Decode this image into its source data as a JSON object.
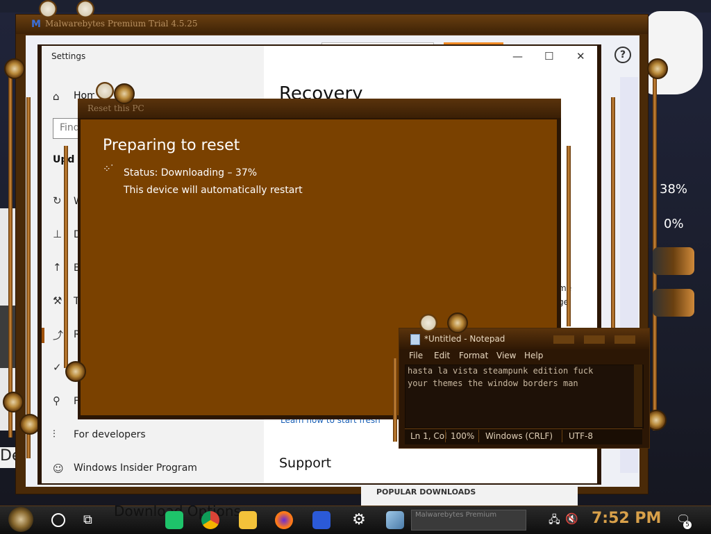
{
  "desktop": {
    "percent_1": "38%",
    "percent_2": "0%",
    "side_text": "Des"
  },
  "malwarebytes": {
    "title": "Malwarebytes Premium Trial  4.5.25",
    "help_glyph": "?",
    "popular_downloads_label": "POPULAR DOWNLOADS"
  },
  "settings": {
    "window_title": "Settings",
    "controls": {
      "minimize": "—",
      "maximize": "☐",
      "close": "✕"
    },
    "sidebar": {
      "home_label": "Home",
      "search_placeholder": "Find",
      "section_heading": "Upd",
      "nav_letters": [
        "W",
        "D",
        "B",
        "T",
        "R",
        "A",
        "F"
      ],
      "for_developers": "For developers",
      "windows_insider": "Windows Insider Program"
    },
    "main": {
      "page_title": "Recovery",
      "support_heading": "Support",
      "learn_link": "Learn how to start fresh",
      "fragment_1": "me",
      "fragment_2": "ge."
    }
  },
  "reset_dialog": {
    "title": "Reset this PC",
    "heading": "Preparing to reset",
    "spinner": "⁘˙",
    "status": "Status: Downloading – 37%",
    "progress_percent": 37,
    "restart_notice": "This device will automatically restart"
  },
  "notepad": {
    "title": "*Untitled - Notepad",
    "menus": [
      "File",
      "Edit",
      "Format",
      "View",
      "Help"
    ],
    "content_line_1": "hasta la vista steampunk edition fuck",
    "content_line_2": "your themes the window borders man",
    "status": {
      "position": "Ln 1, Col",
      "zoom": "100%",
      "line_ending": "Windows (CRLF)",
      "encoding": "UTF-8"
    }
  },
  "taskbar": {
    "behind_text": "Download Options",
    "preview_text": "Malwarebytes Premium",
    "clock": "7:52 PM",
    "notification_count": "5"
  },
  "colors": {
    "dialog_bg": "#7a4100",
    "accent": "#a0520c",
    "clock": "#d9a14a"
  }
}
